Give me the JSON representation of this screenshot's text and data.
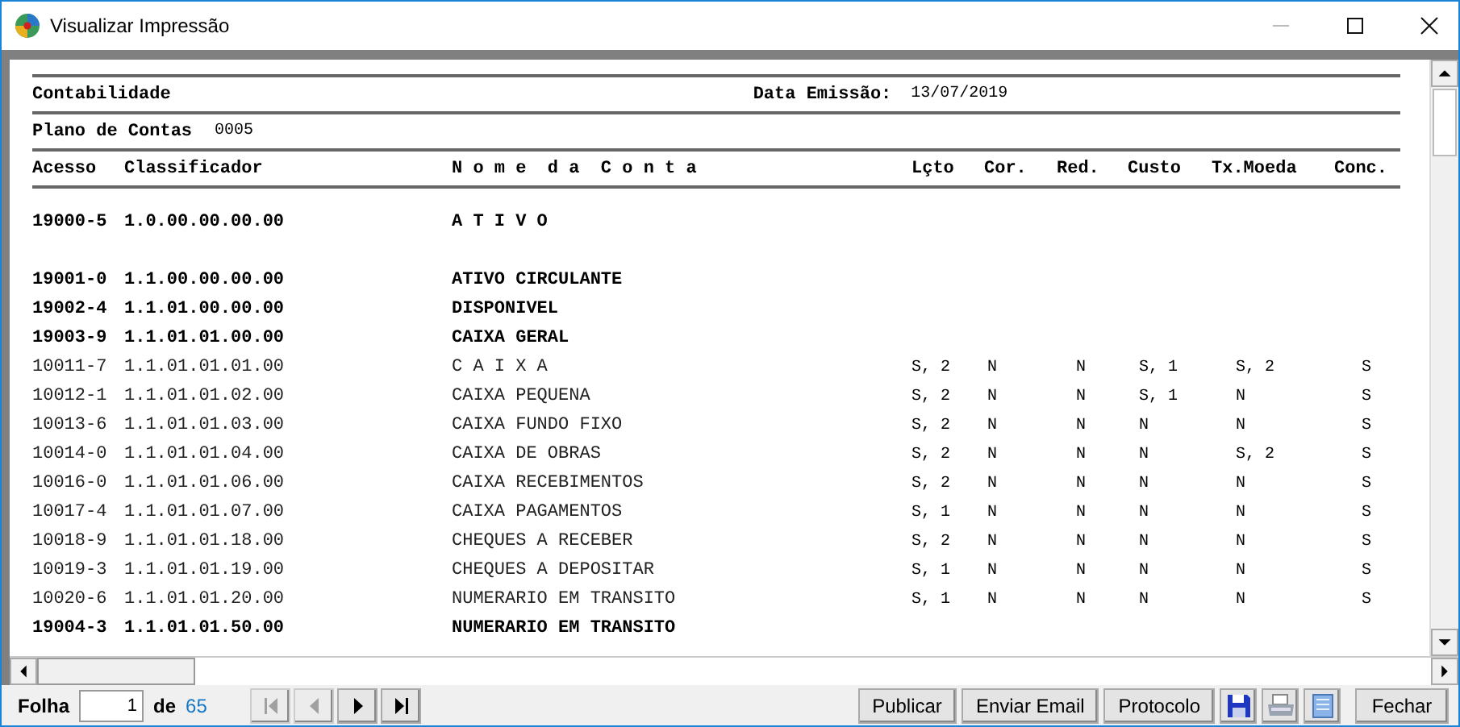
{
  "window": {
    "title": "Visualizar Impressão"
  },
  "report": {
    "company": "Contabilidade",
    "date_label": "Data Emissão:",
    "date": "13/07/2019",
    "plan_label": "Plano de Contas",
    "plan": "0005",
    "columns": [
      "Acesso",
      "Classificador",
      "N o m e  d a  C o n t a",
      "Lçto",
      "Cor.",
      "Red.",
      "Custo",
      "Tx.Moeda",
      "Conc."
    ],
    "rows": [
      {
        "acesso": "19000-5",
        "classificador": "1.0.00.00.00.00",
        "nome": "A T I V O",
        "bold": true
      },
      {
        "acesso": "19001-0",
        "classificador": "1.1.00.00.00.00",
        "nome": "ATIVO CIRCULANTE",
        "bold": true
      },
      {
        "acesso": "19002-4",
        "classificador": "1.1.01.00.00.00",
        "nome": "DISPONIVEL",
        "bold": true
      },
      {
        "acesso": "19003-9",
        "classificador": "1.1.01.01.00.00",
        "nome": "CAIXA GERAL",
        "bold": true
      },
      {
        "acesso": "10011-7",
        "classificador": "1.1.01.01.01.00",
        "nome": "C A I X A",
        "lcto": "S, 2",
        "cor": "N",
        "red": "N",
        "custo": "S, 1",
        "tx_moeda": "S, 2",
        "conc": "S",
        "bold": false
      },
      {
        "acesso": "10012-1",
        "classificador": "1.1.01.01.02.00",
        "nome": "CAIXA PEQUENA",
        "lcto": "S, 2",
        "cor": "N",
        "red": "N",
        "custo": "S, 1",
        "tx_moeda": "N",
        "conc": "S",
        "bold": false
      },
      {
        "acesso": "10013-6",
        "classificador": "1.1.01.01.03.00",
        "nome": "CAIXA FUNDO FIXO",
        "lcto": "S, 2",
        "cor": "N",
        "red": "N",
        "custo": "N",
        "tx_moeda": "N",
        "conc": "S",
        "bold": false
      },
      {
        "acesso": "10014-0",
        "classificador": "1.1.01.01.04.00",
        "nome": "CAIXA DE OBRAS",
        "lcto": "S, 2",
        "cor": "N",
        "red": "N",
        "custo": "N",
        "tx_moeda": "S, 2",
        "conc": "S",
        "bold": false
      },
      {
        "acesso": "10016-0",
        "classificador": "1.1.01.01.06.00",
        "nome": "CAIXA RECEBIMENTOS",
        "lcto": "S, 2",
        "cor": "N",
        "red": "N",
        "custo": "N",
        "tx_moeda": "N",
        "conc": "S",
        "bold": false
      },
      {
        "acesso": "10017-4",
        "classificador": "1.1.01.01.07.00",
        "nome": "CAIXA PAGAMENTOS",
        "lcto": "S, 1",
        "cor": "N",
        "red": "N",
        "custo": "N",
        "tx_moeda": "N",
        "conc": "S",
        "bold": false
      },
      {
        "acesso": "10018-9",
        "classificador": "1.1.01.01.18.00",
        "nome": "CHEQUES A RECEBER",
        "lcto": "S, 2",
        "cor": "N",
        "red": "N",
        "custo": "N",
        "tx_moeda": "N",
        "conc": "S",
        "bold": false
      },
      {
        "acesso": "10019-3",
        "classificador": "1.1.01.01.19.00",
        "nome": "CHEQUES A DEPOSITAR",
        "lcto": "S, 1",
        "cor": "N",
        "red": "N",
        "custo": "N",
        "tx_moeda": "N",
        "conc": "S",
        "bold": false
      },
      {
        "acesso": "10020-6",
        "classificador": "1.1.01.01.20.00",
        "nome": "NUMERARIO EM TRANSITO",
        "lcto": "S, 1",
        "cor": "N",
        "red": "N",
        "custo": "N",
        "tx_moeda": "N",
        "conc": "S",
        "bold": false
      },
      {
        "acesso": "19004-3",
        "classificador": "1.1.01.01.50.00",
        "nome": "NUMERARIO EM TRANSITO",
        "bold": true
      }
    ]
  },
  "pager": {
    "label": "Folha",
    "page": "1",
    "of_label": "de",
    "total": "65",
    "nav": [
      {
        "kind": "first",
        "disabled": true
      },
      {
        "kind": "prev",
        "disabled": true
      },
      {
        "kind": "next",
        "disabled": false
      },
      {
        "kind": "last",
        "disabled": false
      }
    ]
  },
  "actions": [
    {
      "kind": "text",
      "label": "Publicar"
    },
    {
      "kind": "text",
      "label": "Enviar Email"
    },
    {
      "kind": "text",
      "label": "Protocolo"
    },
    {
      "kind": "save"
    },
    {
      "kind": "print"
    },
    {
      "kind": "doc"
    },
    {
      "kind": "text",
      "label": "Fechar"
    }
  ]
}
